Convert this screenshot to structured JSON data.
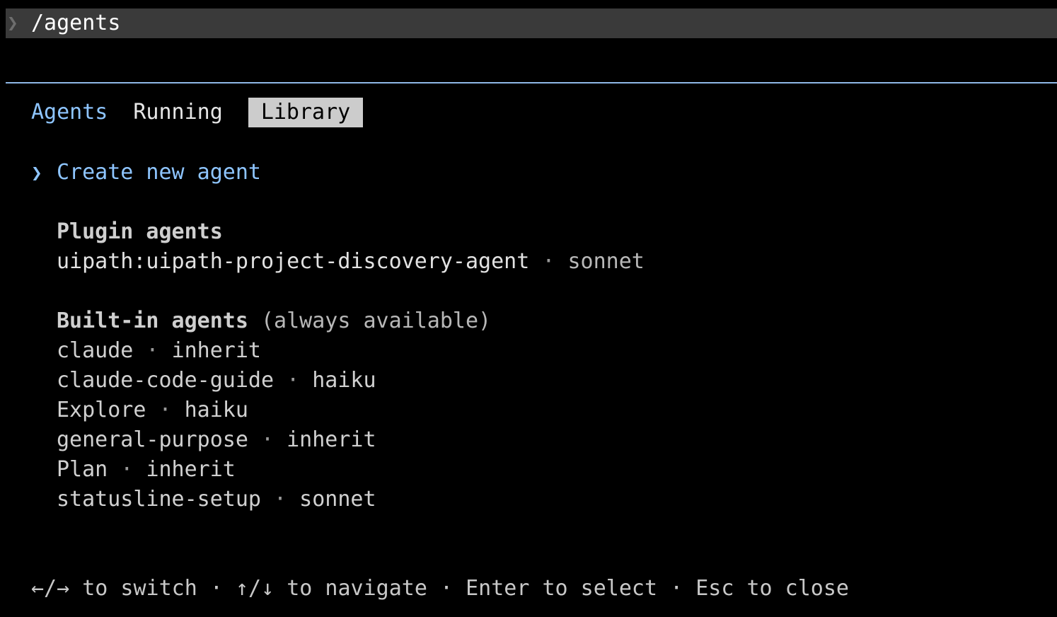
{
  "command": {
    "prompt_icon": "chevron-right-icon",
    "prompt_glyph": "❯",
    "text": "/agents"
  },
  "tabs": [
    {
      "label": "Agents"
    },
    {
      "label": "Running"
    },
    {
      "label": "Library"
    }
  ],
  "create": {
    "chevron": "❯",
    "label": "Create new agent"
  },
  "plugin_section": {
    "title": "Plugin agents",
    "items": [
      {
        "name": "uipath:uipath-project-discovery-agent",
        "model": "sonnet"
      }
    ]
  },
  "builtin_section": {
    "title": "Built-in agents",
    "note": "(always available)",
    "items": [
      {
        "name": "claude",
        "model": "inherit"
      },
      {
        "name": "claude-code-guide",
        "model": "haiku"
      },
      {
        "name": "Explore",
        "model": "haiku"
      },
      {
        "name": "general-purpose",
        "model": "inherit"
      },
      {
        "name": "Plan",
        "model": "inherit"
      },
      {
        "name": "statusline-setup",
        "model": "sonnet"
      }
    ]
  },
  "separator": " · ",
  "footer": {
    "text": "←/→ to switch · ↑/↓ to navigate · Enter to select · Esc to close"
  },
  "colors": {
    "accent": "#8ec5ff",
    "divider": "#8fb8e6",
    "selected_tab_bg": "#cccccc",
    "command_bar_bg": "#3a3a3a"
  }
}
